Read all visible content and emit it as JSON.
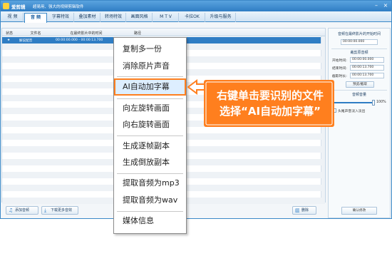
{
  "window": {
    "app_name": "爱剪辑",
    "slogan": "超易用、强大的视频剪辑软件",
    "controls": [
      "–",
      "×"
    ]
  },
  "tabs": [
    {
      "label": "视  频",
      "active": false
    },
    {
      "label": "音  频",
      "active": true
    },
    {
      "label": "字幕特效",
      "active": false
    },
    {
      "label": "叠加素材",
      "active": false
    },
    {
      "label": "转场特效",
      "active": false
    },
    {
      "label": "画面风格",
      "active": false
    },
    {
      "label": "M T V",
      "active": false
    },
    {
      "label": "卡拉OK",
      "active": false
    },
    {
      "label": "升级与服务",
      "active": false
    }
  ],
  "table": {
    "columns": [
      "状态",
      "文件名",
      "在最终影片中的时间",
      "路径"
    ],
    "rows": [
      {
        "status": "★",
        "name": "解说配音",
        "time": "00:00:00.000 - 00:00:13.700",
        "path": ""
      }
    ]
  },
  "bottom_toolbar": {
    "add_audio": "添加音频",
    "download_more": "下载更多音效",
    "delete": "删除"
  },
  "right_panel": {
    "start_time_title": "音频在最终影片的开始时间",
    "start_time_value": "00:00:00.000",
    "trim_title": "裁剪原音频",
    "start_label": "开始时间:",
    "start_value": "00:00:00.000",
    "end_label": "结束时间:",
    "end_value": "00:00:13.700",
    "duration_label": "截取时长:",
    "duration_value": "00:00:13.700",
    "preview_button": "预览/截取",
    "volume_title": "音频音量",
    "volume_value": "100%",
    "volume_level": 1.0,
    "fade_label": "头尾声音淡入淡出",
    "confirm_button": "确认修改"
  },
  "context_menu": {
    "items": [
      {
        "label": "复制多一份",
        "highlighted": false
      },
      {
        "label": "消除原片声音",
        "highlighted": false
      },
      {
        "label": "AI自动加字幕",
        "highlighted": true
      },
      {
        "label": "向左旋转画面",
        "highlighted": false
      },
      {
        "label": "向右旋转画面",
        "highlighted": false
      },
      {
        "label": "生成逐帧副本",
        "highlighted": false
      },
      {
        "label": "生成倒放副本",
        "highlighted": false
      },
      {
        "label": "提取音频为mp3",
        "highlighted": false
      },
      {
        "label": "提取音频为wav",
        "highlighted": false
      },
      {
        "label": "媒体信息",
        "highlighted": false
      }
    ]
  },
  "callout": {
    "line1": "右键单击要识别的文件",
    "line2": "选择“AI自动加字幕”"
  },
  "colors": {
    "accent": "#2f7dc4",
    "callout": "#ff7f1e",
    "highlight_border": "#ff7f1e"
  }
}
